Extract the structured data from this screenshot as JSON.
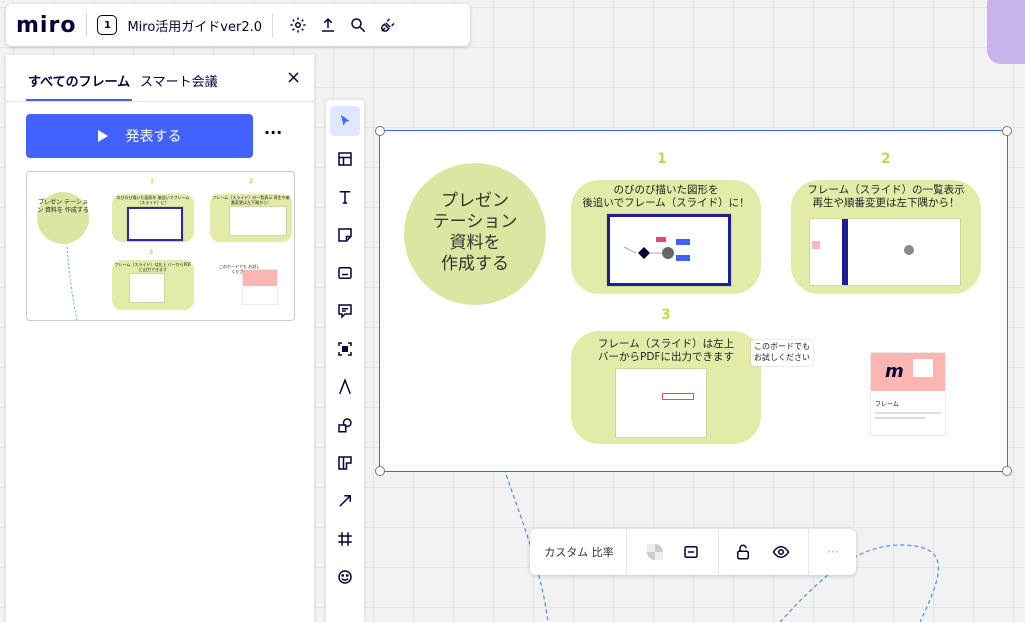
{
  "app": {
    "logo": "miro",
    "board_badge": "1",
    "board_title": "Miro活用ガイドver2.0"
  },
  "panel": {
    "tabs": [
      "すべてのフレーム",
      "スマート会議"
    ],
    "close": "×",
    "present_label": "発表する",
    "more": "···",
    "thumb": {
      "num1": "1",
      "num2": "2",
      "num3": "3",
      "circle": "プレゼン テーション 資料を 作成する",
      "cap1": "のびのび描いた図形を 後追いでフレーム（スライド）に！",
      "cap2": "フレーム（スライド）の一覧表示 再生や順番変更は左下隅から！",
      "cap3": "フレーム（スライド）は左上 バーからPDFに出力できます",
      "note": "このボードでも お試しください"
    }
  },
  "frame": {
    "circle_text": [
      "プレゼン",
      "テーション",
      "資料を",
      "作成する"
    ],
    "num1": "1",
    "num2": "2",
    "num3": "3",
    "caption1": [
      "のびのび描いた図形を",
      "後追いでフレーム（スライド）に！"
    ],
    "caption2": [
      "フレーム（スライド）の一覧表示",
      "再生や順番変更は左下隅から！"
    ],
    "caption3": [
      "フレーム（スライド）は左上",
      "バーからPDFに出力できます"
    ],
    "note": [
      "このボードでも",
      "お試しください"
    ],
    "card_title": "フレーム"
  },
  "context_menu": {
    "aspect_label": "カスタム 比率",
    "more": "···"
  },
  "colors": {
    "accent": "#4262ff",
    "sticky_green": "#e2eba8",
    "number_green": "#c8d84a"
  }
}
